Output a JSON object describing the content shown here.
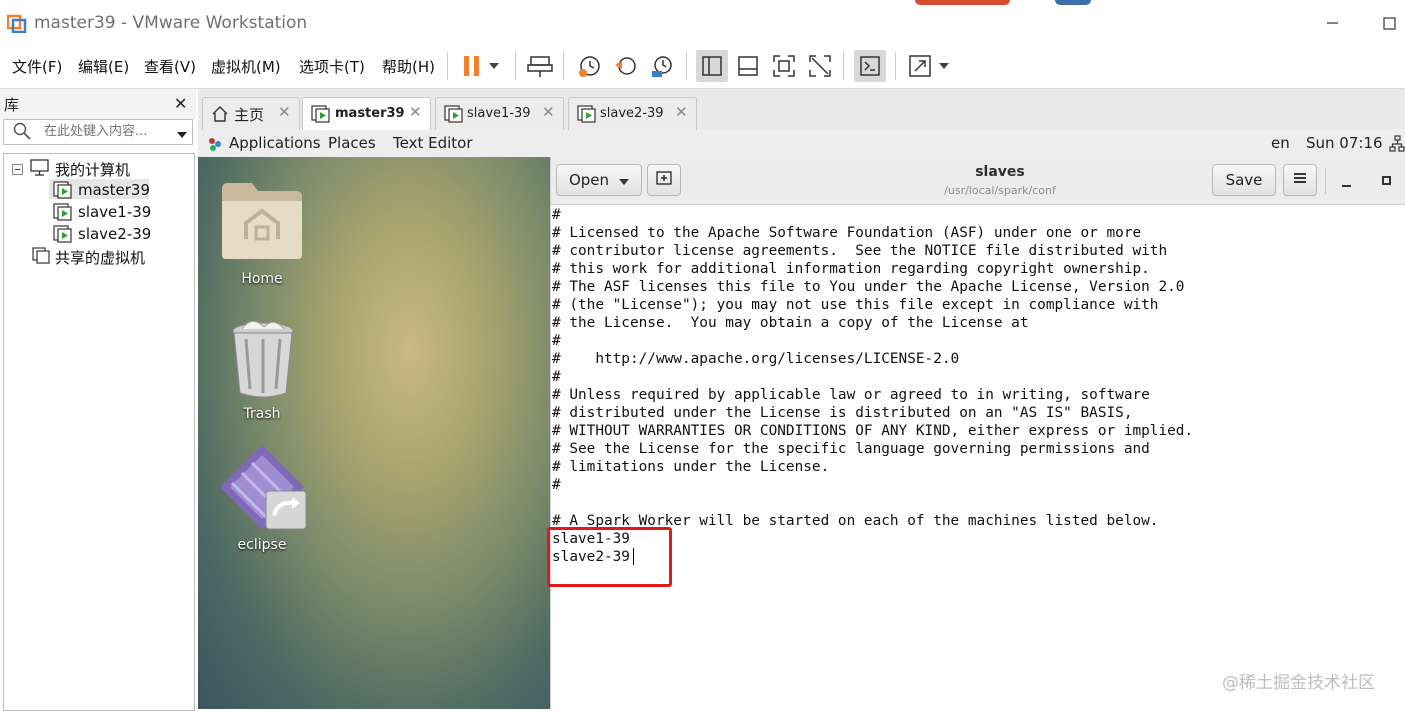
{
  "window": {
    "title": "master39 - VMware Workstation"
  },
  "menubar": {
    "items": [
      "文件(F)",
      "编辑(E)",
      "查看(V)",
      "虚拟机(M)",
      "选项卡(T)",
      "帮助(H)"
    ]
  },
  "toolbar": {
    "icons": [
      "pause-icon",
      "dropdown-arrow-icon",
      "send-keys-icon",
      "snapshot-icon",
      "revert-snapshot-icon",
      "snapshot-manager-icon",
      "show-library-icon",
      "thumbnail-bar-icon",
      "full-screen-icon",
      "unity-icon",
      "console-icon",
      "stretch-icon",
      "dropdown-arrow-icon"
    ],
    "accent_color": "#f0802c"
  },
  "library": {
    "title": "库",
    "search_placeholder": "在此处键入内容...",
    "tree": {
      "root": "我的计算机",
      "vms": [
        "master39",
        "slave1-39",
        "slave2-39"
      ],
      "shared": "共享的虚拟机"
    }
  },
  "tabs": [
    {
      "label": "主页",
      "active": false
    },
    {
      "label": "master39",
      "active": true
    },
    {
      "label": "slave1-39",
      "active": false
    },
    {
      "label": "slave2-39",
      "active": false
    }
  ],
  "guest": {
    "topbar": {
      "applications": "Applications",
      "places": "Places",
      "app": "Text Editor",
      "lang": "en",
      "clock": "Sun 07:16"
    },
    "desktop": {
      "icons": [
        "Home",
        "Trash",
        "eclipse"
      ]
    },
    "gedit": {
      "open_label": "Open",
      "save_label": "Save",
      "doc_title": "slaves",
      "doc_path": "/usr/local/spark/conf",
      "content": "#\n# Licensed to the Apache Software Foundation (ASF) under one or more\n# contributor license agreements.  See the NOTICE file distributed with\n# this work for additional information regarding copyright ownership.\n# The ASF licenses this file to You under the Apache License, Version 2.0\n# (the \"License\"); you may not use this file except in compliance with\n# the License.  You may obtain a copy of the License at\n#\n#    http://www.apache.org/licenses/LICENSE-2.0\n#\n# Unless required by applicable law or agreed to in writing, software\n# distributed under the License is distributed on an \"AS IS\" BASIS,\n# WITHOUT WARRANTIES OR CONDITIONS OF ANY KIND, either express or implied.\n# See the License for the specific language governing permissions and\n# limitations under the License.\n#\n\n# A Spark Worker will be started on each of the machines listed below.\nslave1-39\nslave2-39",
      "highlight_color": "#e01919"
    }
  },
  "watermark": "@稀土掘金技术社区"
}
